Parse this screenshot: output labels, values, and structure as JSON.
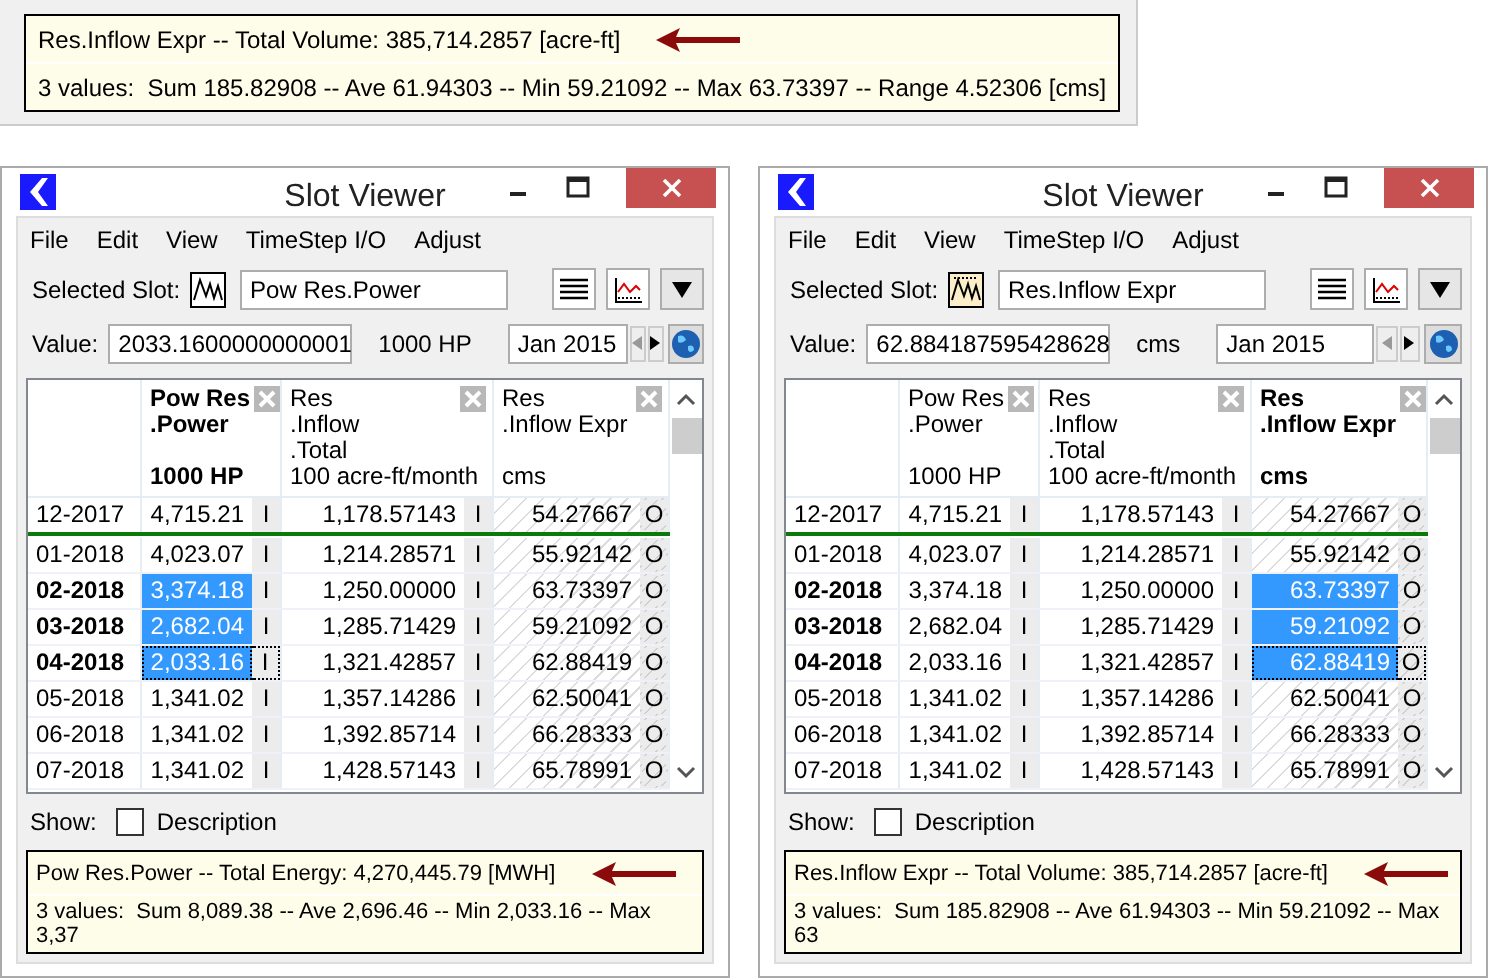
{
  "summary_panel": {
    "lines": [
      "Res.Inflow Expr -- Total Volume: 385,714.2857 [acre-ft]",
      "3 values:  Sum 185.82908 -- Ave 61.94303 -- Min 59.21092 -- Max 63.73397 -- Range 4.52306 [cms]"
    ]
  },
  "windows": [
    {
      "title": "Slot Viewer",
      "menu": [
        "File",
        "Edit",
        "View",
        "TimeStep I/O",
        "Adjust"
      ],
      "slot_label": "Selected Slot:",
      "slot": {
        "kind": "series",
        "name": "Pow Res.Power"
      },
      "value_label": "Value:",
      "value": "2033.1600000000001",
      "unit": "1000 HP",
      "date": "Jan 2015",
      "columns": [
        {
          "title": [
            "Pow Res",
            ".Power"
          ],
          "unit": "1000 HP",
          "selected": true,
          "kind": "input"
        },
        {
          "title": [
            "Res",
            ".Inflow",
            ".Total"
          ],
          "unit": "100 acre-ft/month",
          "selected": false,
          "kind": "input"
        },
        {
          "title": [
            "Res",
            ".Inflow Expr"
          ],
          "unit": "cms",
          "selected": false,
          "kind": "output"
        }
      ],
      "rows": [
        {
          "date": "12-2017",
          "selected": false,
          "cells": [
            {
              "value": "4,715.21",
              "flag": "I",
              "selected": false,
              "focused": false
            },
            {
              "value": "1,178.57143",
              "flag": "I",
              "selected": false,
              "focused": false
            },
            {
              "value": "54.27667",
              "flag": "O",
              "selected": false,
              "focused": false
            }
          ]
        },
        {
          "date": "01-2018",
          "selected": false,
          "cells": [
            {
              "value": "4,023.07",
              "flag": "I",
              "selected": false,
              "focused": false
            },
            {
              "value": "1,214.28571",
              "flag": "I",
              "selected": false,
              "focused": false
            },
            {
              "value": "55.92142",
              "flag": "O",
              "selected": false,
              "focused": false
            }
          ]
        },
        {
          "date": "02-2018",
          "selected": true,
          "cells": [
            {
              "value": "3,374.18",
              "flag": "I",
              "selected": true,
              "focused": false
            },
            {
              "value": "1,250.00000",
              "flag": "I",
              "selected": false,
              "focused": false
            },
            {
              "value": "63.73397",
              "flag": "O",
              "selected": false,
              "focused": false
            }
          ]
        },
        {
          "date": "03-2018",
          "selected": true,
          "cells": [
            {
              "value": "2,682.04",
              "flag": "I",
              "selected": true,
              "focused": false
            },
            {
              "value": "1,285.71429",
              "flag": "I",
              "selected": false,
              "focused": false
            },
            {
              "value": "59.21092",
              "flag": "O",
              "selected": false,
              "focused": false
            }
          ]
        },
        {
          "date": "04-2018",
          "selected": true,
          "cells": [
            {
              "value": "2,033.16",
              "flag": "I",
              "selected": true,
              "focused": true
            },
            {
              "value": "1,321.42857",
              "flag": "I",
              "selected": false,
              "focused": false
            },
            {
              "value": "62.88419",
              "flag": "O",
              "selected": false,
              "focused": false
            }
          ]
        },
        {
          "date": "05-2018",
          "selected": false,
          "cells": [
            {
              "value": "1,341.02",
              "flag": "I",
              "selected": false,
              "focused": false
            },
            {
              "value": "1,357.14286",
              "flag": "I",
              "selected": false,
              "focused": false
            },
            {
              "value": "62.50041",
              "flag": "O",
              "selected": false,
              "focused": false
            }
          ]
        },
        {
          "date": "06-2018",
          "selected": false,
          "cells": [
            {
              "value": "1,341.02",
              "flag": "I",
              "selected": false,
              "focused": false
            },
            {
              "value": "1,392.85714",
              "flag": "I",
              "selected": false,
              "focused": false
            },
            {
              "value": "66.28333",
              "flag": "O",
              "selected": false,
              "focused": false
            }
          ]
        },
        {
          "date": "07-2018",
          "selected": false,
          "cells": [
            {
              "value": "1,341.02",
              "flag": "I",
              "selected": false,
              "focused": false
            },
            {
              "value": "1,428.57143",
              "flag": "I",
              "selected": false,
              "focused": false
            },
            {
              "value": "65.78991",
              "flag": "O",
              "selected": false,
              "focused": false
            }
          ]
        }
      ],
      "show_label": "Show:",
      "description": {
        "label": "Description",
        "checked": false
      },
      "summary": [
        "Pow Res.Power -- Total Energy: 4,270,445.79 [MWH]",
        "3 values:  Sum 8,089.38 -- Ave 2,696.46 -- Min 2,033.16 -- Max 3,37"
      ]
    },
    {
      "title": "Slot Viewer",
      "menu": [
        "File",
        "Edit",
        "View",
        "TimeStep I/O",
        "Adjust"
      ],
      "slot_label": "Selected Slot:",
      "slot": {
        "kind": "expression",
        "name": "Res.Inflow Expr"
      },
      "value_label": "Value:",
      "value": "62.884187595428628",
      "unit": "cms",
      "date": "Jan 2015",
      "columns": [
        {
          "title": [
            "Pow Res",
            ".Power"
          ],
          "unit": "1000 HP",
          "selected": false,
          "kind": "input"
        },
        {
          "title": [
            "Res",
            ".Inflow",
            ".Total"
          ],
          "unit": "100 acre-ft/month",
          "selected": false,
          "kind": "input"
        },
        {
          "title": [
            "Res",
            ".Inflow Expr"
          ],
          "unit": "cms",
          "selected": true,
          "kind": "output"
        }
      ],
      "rows": [
        {
          "date": "12-2017",
          "selected": false,
          "cells": [
            {
              "value": "4,715.21",
              "flag": "I",
              "selected": false,
              "focused": false
            },
            {
              "value": "1,178.57143",
              "flag": "I",
              "selected": false,
              "focused": false
            },
            {
              "value": "54.27667",
              "flag": "O",
              "selected": false,
              "focused": false
            }
          ]
        },
        {
          "date": "01-2018",
          "selected": false,
          "cells": [
            {
              "value": "4,023.07",
              "flag": "I",
              "selected": false,
              "focused": false
            },
            {
              "value": "1,214.28571",
              "flag": "I",
              "selected": false,
              "focused": false
            },
            {
              "value": "55.92142",
              "flag": "O",
              "selected": false,
              "focused": false
            }
          ]
        },
        {
          "date": "02-2018",
          "selected": true,
          "cells": [
            {
              "value": "3,374.18",
              "flag": "I",
              "selected": false,
              "focused": false
            },
            {
              "value": "1,250.00000",
              "flag": "I",
              "selected": false,
              "focused": false
            },
            {
              "value": "63.73397",
              "flag": "O",
              "selected": true,
              "focused": false
            }
          ]
        },
        {
          "date": "03-2018",
          "selected": true,
          "cells": [
            {
              "value": "2,682.04",
              "flag": "I",
              "selected": false,
              "focused": false
            },
            {
              "value": "1,285.71429",
              "flag": "I",
              "selected": false,
              "focused": false
            },
            {
              "value": "59.21092",
              "flag": "O",
              "selected": true,
              "focused": false
            }
          ]
        },
        {
          "date": "04-2018",
          "selected": true,
          "cells": [
            {
              "value": "2,033.16",
              "flag": "I",
              "selected": false,
              "focused": false
            },
            {
              "value": "1,321.42857",
              "flag": "I",
              "selected": false,
              "focused": false
            },
            {
              "value": "62.88419",
              "flag": "O",
              "selected": true,
              "focused": true
            }
          ]
        },
        {
          "date": "05-2018",
          "selected": false,
          "cells": [
            {
              "value": "1,341.02",
              "flag": "I",
              "selected": false,
              "focused": false
            },
            {
              "value": "1,357.14286",
              "flag": "I",
              "selected": false,
              "focused": false
            },
            {
              "value": "62.50041",
              "flag": "O",
              "selected": false,
              "focused": false
            }
          ]
        },
        {
          "date": "06-2018",
          "selected": false,
          "cells": [
            {
              "value": "1,341.02",
              "flag": "I",
              "selected": false,
              "focused": false
            },
            {
              "value": "1,392.85714",
              "flag": "I",
              "selected": false,
              "focused": false
            },
            {
              "value": "66.28333",
              "flag": "O",
              "selected": false,
              "focused": false
            }
          ]
        },
        {
          "date": "07-2018",
          "selected": false,
          "cells": [
            {
              "value": "1,341.02",
              "flag": "I",
              "selected": false,
              "focused": false
            },
            {
              "value": "1,428.57143",
              "flag": "I",
              "selected": false,
              "focused": false
            },
            {
              "value": "65.78991",
              "flag": "O",
              "selected": false,
              "focused": false
            }
          ]
        }
      ],
      "show_label": "Show:",
      "description": {
        "label": "Description",
        "checked": false
      },
      "summary": [
        "Res.Inflow Expr -- Total Volume: 385,714.2857 [acre-ft]",
        "3 values:  Sum 185.82908 -- Ave 61.94303 -- Min 59.21092 -- Max 63"
      ]
    }
  ]
}
